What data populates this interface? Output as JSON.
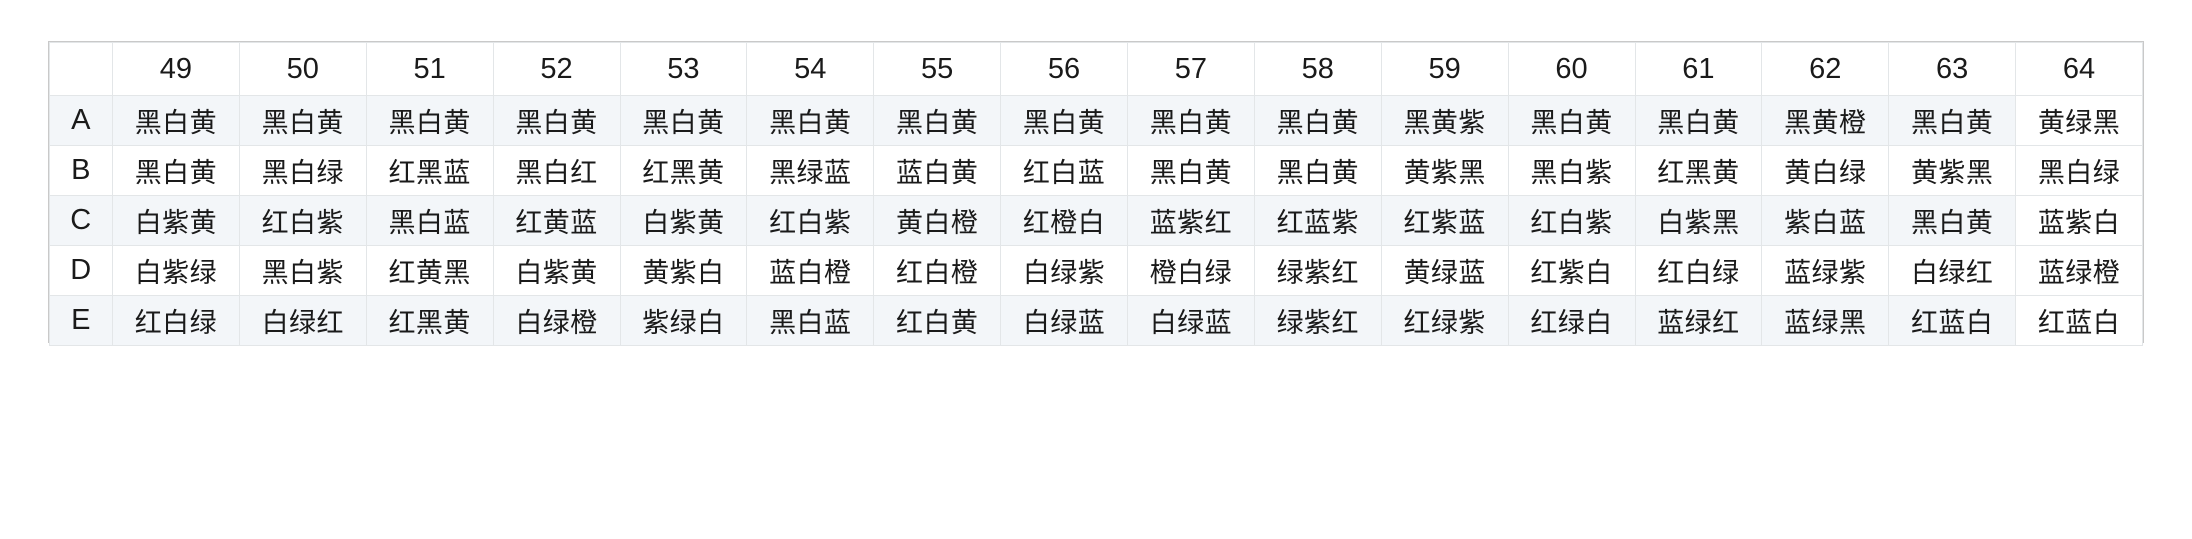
{
  "table": {
    "corner_label": "",
    "column_headers": [
      "49",
      "50",
      "51",
      "52",
      "53",
      "54",
      "55",
      "56",
      "57",
      "58",
      "59",
      "60",
      "61",
      "62",
      "63",
      "64"
    ],
    "row_labels": [
      "A",
      "B",
      "C",
      "D",
      "E"
    ],
    "rows": [
      {
        "label": "A",
        "cells": [
          "黑白黄",
          "黑白黄",
          "黑白黄",
          "黑白黄",
          "黑白黄",
          "黑白黄",
          "黑白黄",
          "黑白黄",
          "黑白黄",
          "黑白黄",
          "黑黄紫",
          "黑白黄",
          "黑白黄",
          "黑黄橙",
          "黑白黄",
          "黄绿黑"
        ]
      },
      {
        "label": "B",
        "cells": [
          "黑白黄",
          "黑白绿",
          "红黑蓝",
          "黑白红",
          "红黑黄",
          "黑绿蓝",
          "蓝白黄",
          "红白蓝",
          "黑白黄",
          "黑白黄",
          "黄紫黑",
          "黑白紫",
          "红黑黄",
          "黄白绿",
          "黄紫黑",
          "黑白绿"
        ]
      },
      {
        "label": "C",
        "cells": [
          "白紫黄",
          "红白紫",
          "黑白蓝",
          "红黄蓝",
          "白紫黄",
          "红白紫",
          "黄白橙",
          "红橙白",
          "蓝紫红",
          "红蓝紫",
          "红紫蓝",
          "红白紫",
          "白紫黑",
          "紫白蓝",
          "黑白黄",
          "蓝紫白"
        ]
      },
      {
        "label": "D",
        "cells": [
          "白紫绿",
          "黑白紫",
          "红黄黑",
          "白紫黄",
          "黄紫白",
          "蓝白橙",
          "红白橙",
          "白绿紫",
          "橙白绿",
          "绿紫红",
          "黄绿蓝",
          "红紫白",
          "红白绿",
          "蓝绿紫",
          "白绿红",
          "蓝绿橙"
        ]
      },
      {
        "label": "E",
        "cells": [
          "红白绿",
          "白绿红",
          "红黑黄",
          "白绿橙",
          "紫绿白",
          "黑白蓝",
          "红白黄",
          "白绿蓝",
          "白绿蓝",
          "绿紫红",
          "红绿紫",
          "红绿白",
          "蓝绿红",
          "蓝绿黑",
          "红蓝白",
          "红蓝白"
        ]
      }
    ]
  },
  "style": {
    "stripe_color": "#f3f6f9",
    "border_color": "#e3e6e8",
    "outer_border_color": "#c9c9c9",
    "text_color": "#1a1a1a"
  }
}
